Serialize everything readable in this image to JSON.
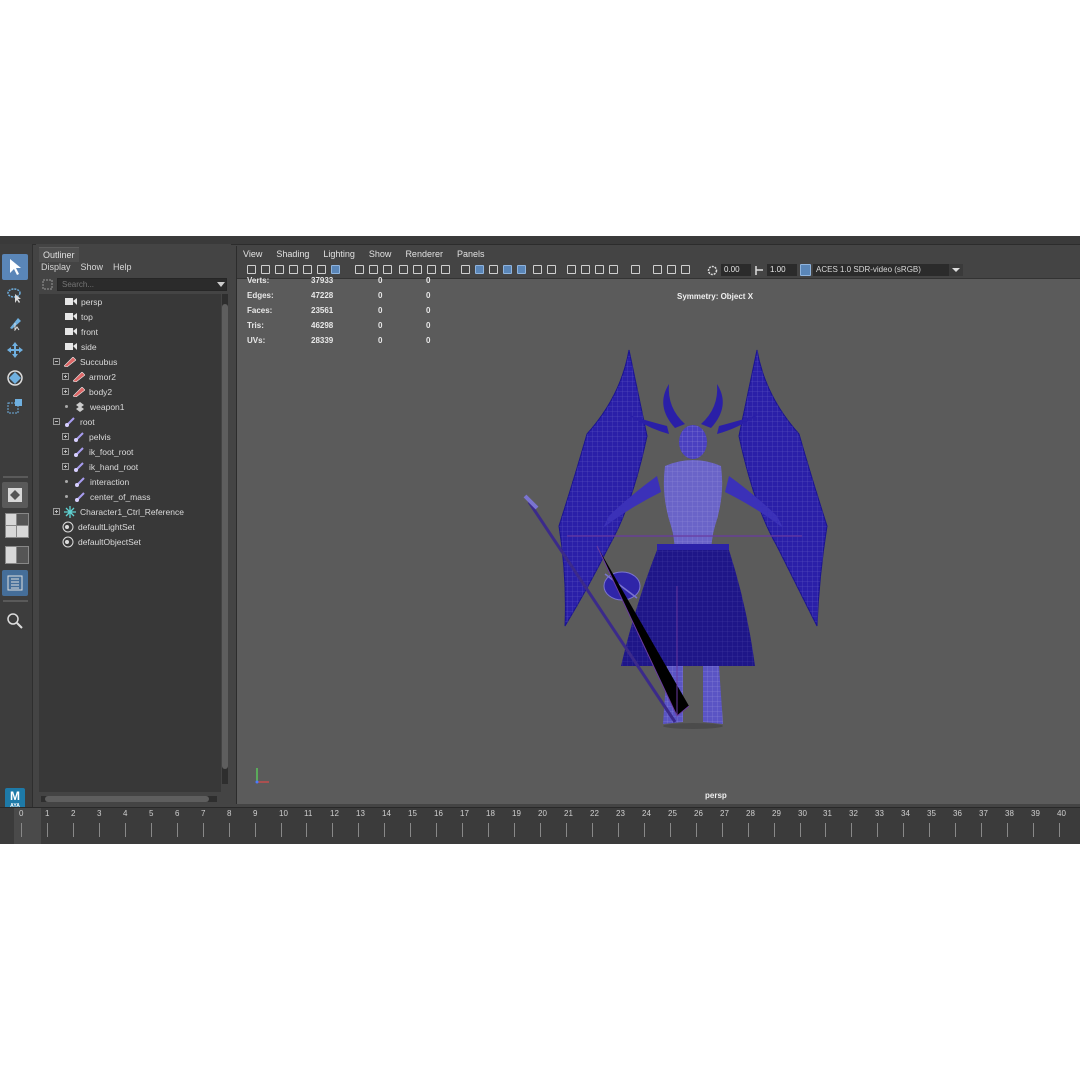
{
  "outliner": {
    "title": "Outliner",
    "menus": [
      "Display",
      "Show",
      "Help"
    ],
    "search_placeholder": "Search...",
    "items": [
      {
        "label": "persp",
        "icon": "camera-icon"
      },
      {
        "label": "top",
        "icon": "camera-icon"
      },
      {
        "label": "front",
        "icon": "camera-icon"
      },
      {
        "label": "side",
        "icon": "camera-icon"
      },
      {
        "label": "Succubus",
        "icon": "mesh-icon"
      },
      {
        "label": "armor2",
        "icon": "mesh-icon"
      },
      {
        "label": "body2",
        "icon": "mesh-icon"
      },
      {
        "label": "weapon1",
        "icon": "group-icon"
      },
      {
        "label": "root",
        "icon": "joint-icon"
      },
      {
        "label": "pelvis",
        "icon": "joint-icon"
      },
      {
        "label": "ik_foot_root",
        "icon": "joint-icon"
      },
      {
        "label": "ik_hand_root",
        "icon": "joint-icon"
      },
      {
        "label": "interaction",
        "icon": "joint-icon"
      },
      {
        "label": "center_of_mass",
        "icon": "joint-icon"
      },
      {
        "label": "Character1_Ctrl_Reference",
        "icon": "locator-icon"
      },
      {
        "label": "defaultLightSet",
        "icon": "set-icon"
      },
      {
        "label": "defaultObjectSet",
        "icon": "set-icon"
      }
    ]
  },
  "viewport": {
    "menus": [
      "View",
      "Shading",
      "Lighting",
      "Show",
      "Renderer",
      "Panels"
    ],
    "exposure": "0.00",
    "gamma": "1.00",
    "color_space": "ACES 1.0 SDR-video (sRGB)",
    "hud": [
      {
        "label": "Verts:",
        "values": [
          "37933",
          "0",
          "0"
        ]
      },
      {
        "label": "Edges:",
        "values": [
          "47228",
          "0",
          "0"
        ]
      },
      {
        "label": "Faces:",
        "values": [
          "23561",
          "0",
          "0"
        ]
      },
      {
        "label": "Tris:",
        "values": [
          "46298",
          "0",
          "0"
        ]
      },
      {
        "label": "UVs:",
        "values": [
          "28339",
          "0",
          "0"
        ]
      }
    ],
    "symmetry": "Symmetry: Object X",
    "camera": "persp"
  },
  "timeline": {
    "frames": [
      "0",
      "1",
      "2",
      "3",
      "4",
      "5",
      "6",
      "7",
      "8",
      "9",
      "10",
      "11",
      "12",
      "13",
      "14",
      "15",
      "16",
      "17",
      "18",
      "19",
      "20",
      "21",
      "22",
      "23",
      "24",
      "25",
      "26",
      "27",
      "28",
      "29",
      "30",
      "31",
      "32",
      "33",
      "34",
      "35",
      "36",
      "37",
      "38",
      "39",
      "40"
    ],
    "current_frame": "0"
  },
  "logo": {
    "letter": "M",
    "sub": "AYA"
  },
  "colors": {
    "accent": "#5a86b8",
    "wire": "#3a2fb8",
    "background": "#5b5b5b"
  }
}
